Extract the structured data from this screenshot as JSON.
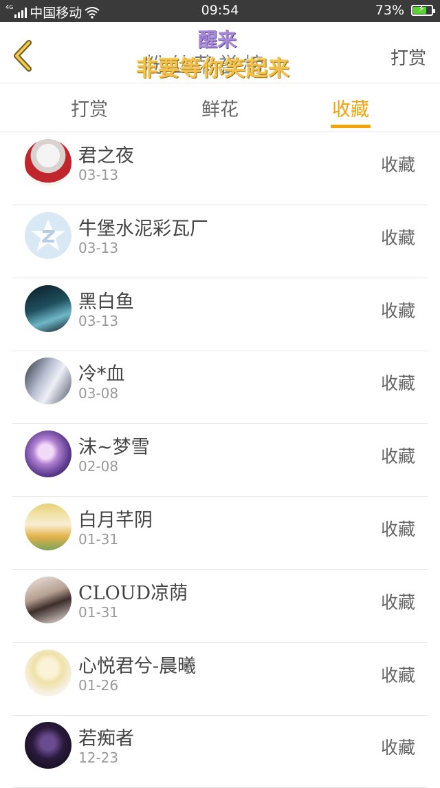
{
  "status_bar": {
    "network_tiny": "4G",
    "carrier": "中国移动",
    "time": "09:54",
    "battery_text": "73%",
    "battery_level": 0.73,
    "icons": [
      "signal-icon",
      "wifi-icon",
      "battery-icon"
    ]
  },
  "header": {
    "back_icon": "chevron-left-icon",
    "title": "粉丝荣誉榜",
    "overlay_top": "醒来",
    "overlay_main": "非要等你笑起来",
    "right_action": "打赏"
  },
  "tabs": [
    {
      "label": "打赏",
      "active": false
    },
    {
      "label": "鲜花",
      "active": false
    },
    {
      "label": "收藏",
      "active": true
    }
  ],
  "colors": {
    "accent": "#f0a30a",
    "status_bar": "#3a3a3a",
    "divider": "#e5e5e5"
  },
  "list": [
    {
      "name": "君之夜",
      "date": "03-13",
      "action": "收藏",
      "avatar": "avatar-red-white-figure"
    },
    {
      "name": "牛堡水泥彩瓦厂",
      "date": "03-13",
      "action": "收藏",
      "avatar": "avatar-default-star"
    },
    {
      "name": "黑白鱼",
      "date": "03-13",
      "action": "收藏",
      "avatar": "avatar-dark-teal"
    },
    {
      "name": "冷*血",
      "date": "03-08",
      "action": "收藏",
      "avatar": "avatar-pale-figures"
    },
    {
      "name": "沫~梦雪",
      "date": "02-08",
      "action": "收藏",
      "avatar": "avatar-purple-girl"
    },
    {
      "name": "白月芊阴",
      "date": "01-31",
      "action": "收藏",
      "avatar": "avatar-yellow-cartoon"
    },
    {
      "name": "CLOUD凉荫",
      "date": "01-31",
      "action": "收藏",
      "avatar": "avatar-long-hair-girl"
    },
    {
      "name": "心悦君兮-晨曦",
      "date": "01-26",
      "action": "收藏",
      "avatar": "avatar-blonde-girl"
    },
    {
      "name": "若痴者",
      "date": "12-23",
      "action": "收藏",
      "avatar": "avatar-dark-purple"
    }
  ]
}
